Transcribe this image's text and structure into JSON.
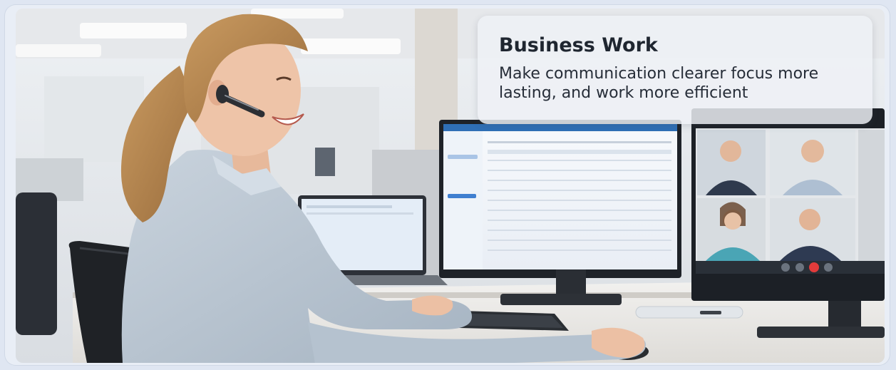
{
  "banner": {
    "title": "Business Work",
    "subtitle": "Make communication clearer focus more lasting, and work more efficient"
  },
  "scene": {
    "photo_subject": "woman-with-headset-at-desk",
    "call_participants": 4,
    "colors": {
      "frame_bg": "#e9eef6",
      "card_bg": "#eef1f6",
      "title_color": "#1f2630",
      "shirt": "#b9c6d3",
      "hair": "#b98a53",
      "end_call_red": "#e23b3b"
    }
  }
}
